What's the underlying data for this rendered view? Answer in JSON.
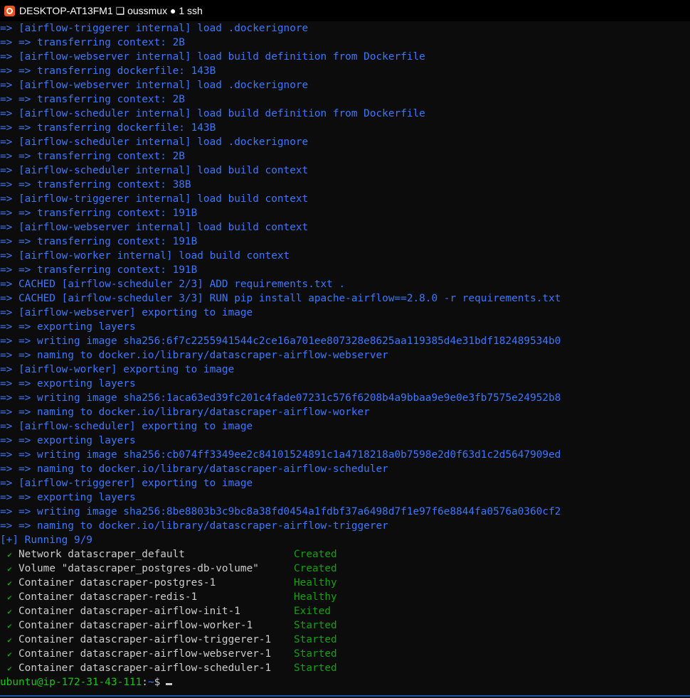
{
  "window": {
    "title": "DESKTOP-AT13FM1 ❏ oussmux ● 1 ssh"
  },
  "build_lines": [
    "=> [airflow-triggerer internal] load .dockerignore",
    "=> => transferring context: 2B",
    "=> [airflow-webserver internal] load build definition from Dockerfile",
    "=> => transferring dockerfile: 143B",
    "=> [airflow-webserver internal] load .dockerignore",
    "=> => transferring context: 2B",
    "=> [airflow-scheduler internal] load build definition from Dockerfile",
    "=> => transferring dockerfile: 143B",
    "=> [airflow-scheduler internal] load .dockerignore",
    "=> => transferring context: 2B",
    "=> [airflow-scheduler internal] load build context",
    "=> => transferring context: 38B",
    "=> [airflow-triggerer internal] load build context",
    "=> => transferring context: 191B",
    "=> [airflow-webserver internal] load build context",
    "=> => transferring context: 191B",
    "=> [airflow-worker internal] load build context",
    "=> => transferring context: 191B",
    "=> CACHED [airflow-scheduler 2/3] ADD requirements.txt .",
    "=> CACHED [airflow-scheduler 3/3] RUN pip install apache-airflow==2.8.0 -r requirements.txt",
    "=> [airflow-webserver] exporting to image",
    "=> => exporting layers",
    "=> => writing image sha256:6f7c2255941544c2ce16a701ee807328e8625aa119385d4e31bdf182489534b0",
    "=> => naming to docker.io/library/datascraper-airflow-webserver",
    "=> [airflow-worker] exporting to image",
    "=> => exporting layers",
    "=> => writing image sha256:1aca63ed39fc201c4fade07231c576f6208b4a9bbaa9e9e0e3fb7575e24952b8",
    "=> => naming to docker.io/library/datascraper-airflow-worker",
    "=> [airflow-scheduler] exporting to image",
    "=> => exporting layers",
    "=> => writing image sha256:cb074ff3349ee2c84101524891c1a4718218a0b7598e2d0f63d1c2d5647909ed",
    "=> => naming to docker.io/library/datascraper-airflow-scheduler",
    "=> [airflow-triggerer] exporting to image",
    "=> => exporting layers",
    "=> => writing image sha256:8be8803b3c9bc8a38fd0454a1fdbf37a6498d7f1e97f6e8844fa0576a0360cf2",
    "=> => naming to docker.io/library/datascraper-airflow-triggerer",
    "[+] Running 9/9"
  ],
  "resources": [
    {
      "name": "Network datascraper_default",
      "status": "Created"
    },
    {
      "name": "Volume \"datascraper_postgres-db-volume\"",
      "status": "Created"
    },
    {
      "name": "Container datascraper-postgres-1",
      "status": "Healthy"
    },
    {
      "name": "Container datascraper-redis-1",
      "status": "Healthy"
    },
    {
      "name": "Container datascraper-airflow-init-1",
      "status": "Exited"
    },
    {
      "name": "Container datascraper-airflow-worker-1",
      "status": "Started"
    },
    {
      "name": "Container datascraper-airflow-triggerer-1",
      "status": "Started"
    },
    {
      "name": "Container datascraper-airflow-webserver-1",
      "status": "Started"
    },
    {
      "name": "Container datascraper-airflow-scheduler-1",
      "status": "Started"
    }
  ],
  "check_glyph": "✔",
  "prompt": {
    "user_host": "ubuntu@ip-172-31-43-111",
    "separator": ":",
    "path": "~",
    "symbol": "$"
  },
  "colors": {
    "background": "#0c0c0c",
    "build_text": "#3b78ff",
    "status_text": "#13a10e",
    "prompt_user": "#16c60c",
    "ubuntu_orange": "#e95420"
  },
  "icons": {
    "title_icon": "ubuntu-logo-icon",
    "resource_icon": "check-mark-icon"
  }
}
